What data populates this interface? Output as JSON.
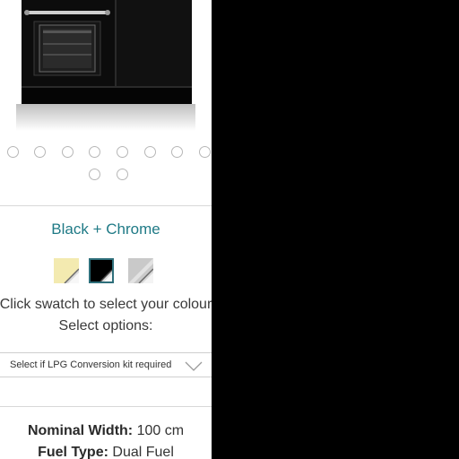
{
  "product": {
    "image_alt": "range-cooker-black-chrome",
    "carousel": {
      "dot_count": 10,
      "active_index": null
    }
  },
  "colour": {
    "selected_name": "Black + Chrome",
    "accent_color": "#1f7a86",
    "swatches": [
      {
        "name": "cream-chrome",
        "color": "#f3eab0"
      },
      {
        "name": "black-chrome",
        "color": "#000000",
        "selected": true
      },
      {
        "name": "stainless-steel",
        "color": "#c9c9c9"
      }
    ],
    "instruction": "Click swatch to select your colour"
  },
  "options": {
    "heading": "Select options:",
    "lpg_select": {
      "value": "Select if LPG Conversion kit required",
      "icon": "chevron-down-icon"
    }
  },
  "specs": [
    {
      "label": "Nominal Width:",
      "value": "100 cm"
    },
    {
      "label": "Fuel Type:",
      "value": "Dual Fuel"
    }
  ]
}
